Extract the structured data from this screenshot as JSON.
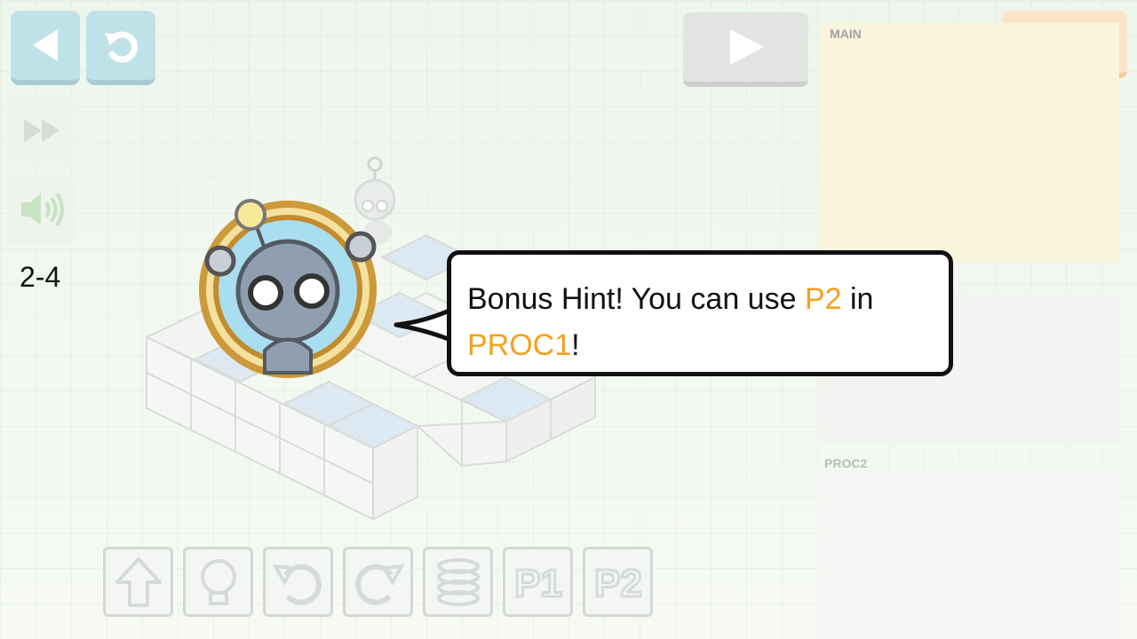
{
  "level": "2-4",
  "panels": {
    "main_label": "MAIN",
    "proc2_label": "PROC2"
  },
  "hint": {
    "part1": "Bonus Hint! You can use ",
    "highlight1": "P2",
    "part2": " in",
    "highlight2": "PROC1",
    "part3": "!"
  },
  "toolbar_items": [
    {
      "name": "forward-icon"
    },
    {
      "name": "light-icon"
    },
    {
      "name": "turn-left-icon"
    },
    {
      "name": "turn-right-icon"
    },
    {
      "name": "jump-icon"
    },
    {
      "name": "p1-icon",
      "label": "P1"
    },
    {
      "name": "p2-icon",
      "label": "P2"
    }
  ],
  "colors": {
    "highlight": "#f4a11c",
    "nav_button": "#bfe2e8",
    "fast_button": "#fbe3c8",
    "main_panel": "#f9f4dc"
  }
}
